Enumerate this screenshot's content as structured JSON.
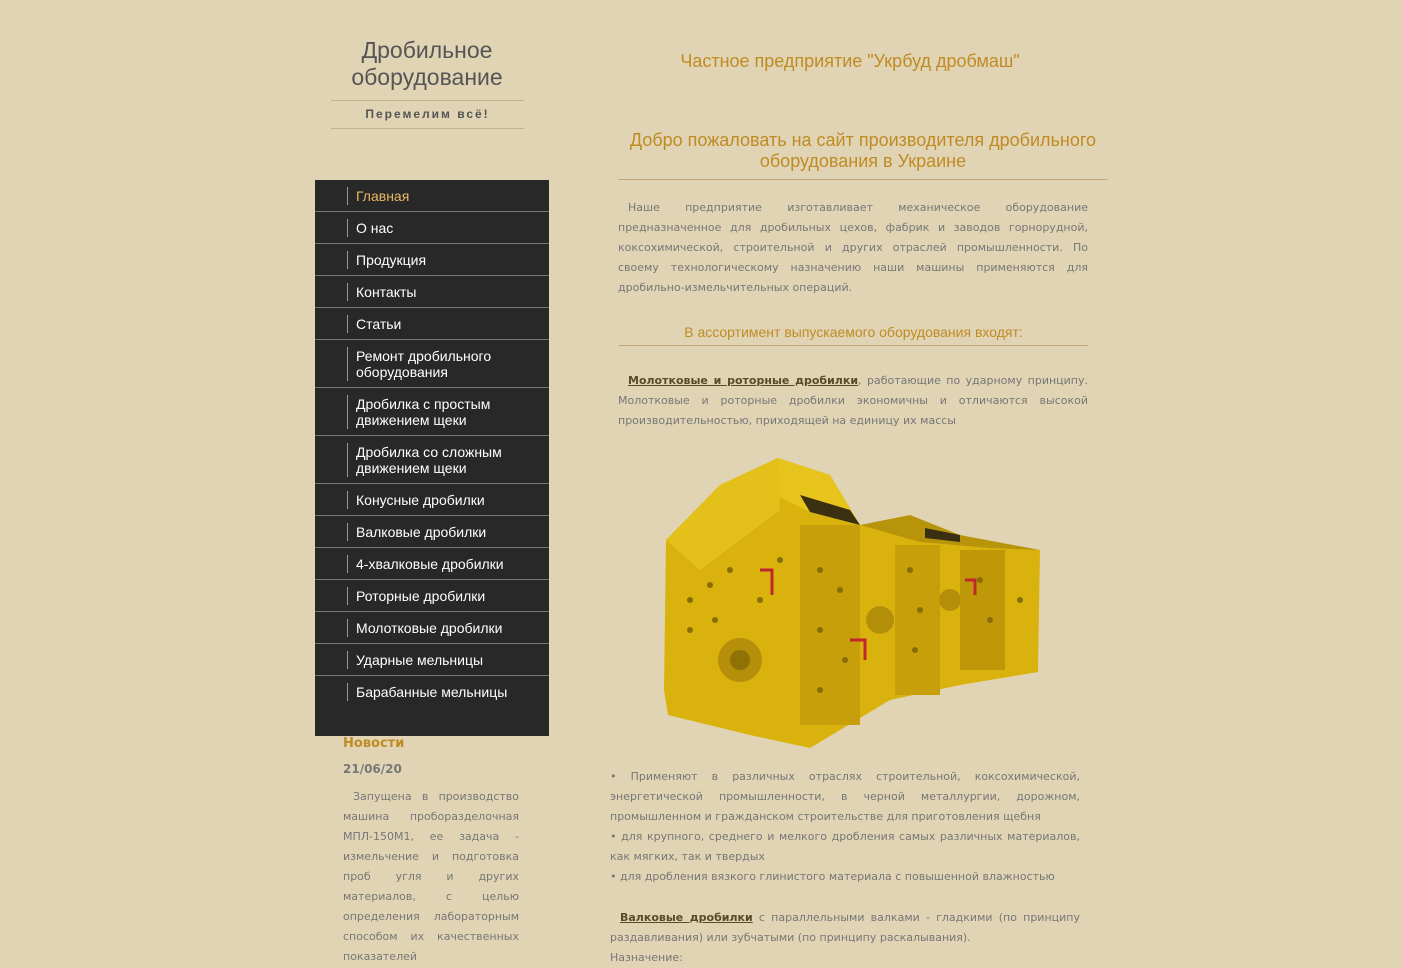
{
  "header": {
    "site_title": "Дробильное оборудование",
    "slogan": "Перемелим всё!",
    "company": "Частное предприятие \"Укрбуд дробмаш\""
  },
  "nav": {
    "items": [
      {
        "label": "Главная",
        "active": true
      },
      {
        "label": "О нас"
      },
      {
        "label": "Продукция"
      },
      {
        "label": "Контакты"
      },
      {
        "label": "Статьи"
      },
      {
        "label": "Ремонт дробильного оборудования"
      },
      {
        "label": "Дробилка с простым движением щеки"
      },
      {
        "label": "Дробилка со сложным движением щеки"
      },
      {
        "label": "Конусные дробилки"
      },
      {
        "label": "Валковые дробилки"
      },
      {
        "label": "4-хвалковые дробилки"
      },
      {
        "label": "Роторные дробилки"
      },
      {
        "label": "Молотковые дробилки"
      },
      {
        "label": "Ударные мельницы"
      },
      {
        "label": "Барабанные мельницы"
      }
    ]
  },
  "news": {
    "title": "Новости",
    "date": "21/06/20",
    "text": "Запущена в производство машина проборазделочная МПЛ-150М1, ее задача - измельчение и подготовка проб угля и других материалов, с целью определения лабораторным способом их качественных показателей"
  },
  "main": {
    "welcome": "Добро пожаловать на сайт производителя дробильного оборудования в Украине",
    "intro": "Наше предприятие изготавливает механическое оборудование предназначенное для дробильных цехов, фабрик и заводов горнорудной, коксохимической, строительной и других отраслей промышленности. По своему технологическому назначению наши машины применяются для дробильно-измельчительных операций.",
    "assortment_heading": "В ассортимент выпускаемого оборудования входят:",
    "hammer_link": "Молотковые и роторные дробилки",
    "hammer_text": ", работающие по ударному принципу. Молотковые и роторные дробилки экономичны и отличаются высокой производительностью, приходящей на единицу их массы",
    "uses": [
      "•  Применяют в различных отраслях строительной, коксохимической, энергетической промышленности, в черной металлургии, дорожном, промышленном и гражданском строительстве для приготовления щебня",
      "• для крупного, среднего и мелкого дробления самых различных материалов, как мягких, так и твердых",
      "• для дробления вязкого глинистого материала с повышенной влажностью"
    ],
    "roll_link": "Валковые дробилки",
    "roll_text": " с параллельными валками - гладкими (по принципу раздавливания) или зубчатыми (по принципу раскалывания).",
    "purpose": "Назначение:"
  }
}
